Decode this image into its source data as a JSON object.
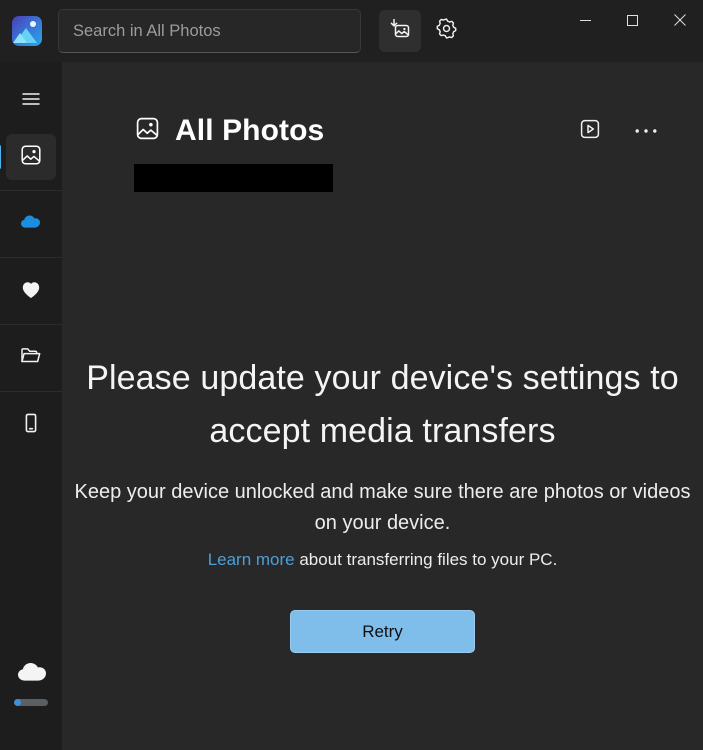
{
  "window": {
    "app_logo": "photos-app-logo",
    "controls": {
      "minimize": "minimize-icon",
      "maximize": "maximize-icon",
      "close": "close-icon"
    }
  },
  "search": {
    "placeholder": "Search in All Photos",
    "value": ""
  },
  "toolbar": {
    "import_icon": "import-photos-icon",
    "settings_icon": "settings-gear-icon"
  },
  "sidebar": {
    "items": [
      {
        "name": "menu",
        "icon": "hamburger-menu-icon",
        "selected": false
      },
      {
        "name": "all-photos",
        "icon": "photos-icon",
        "selected": true
      },
      {
        "name": "onedrive",
        "icon": "cloud-icon",
        "selected": false
      },
      {
        "name": "favorites",
        "icon": "heart-icon",
        "selected": false
      },
      {
        "name": "folders",
        "icon": "folder-icon",
        "selected": false
      },
      {
        "name": "phone",
        "icon": "mobile-device-icon",
        "selected": false
      }
    ],
    "status": {
      "icon": "cloud-sync-icon",
      "progress_percent": 22
    }
  },
  "page": {
    "icon": "photos-icon",
    "title": "All Photos",
    "slideshow_icon": "slideshow-play-icon",
    "more_icon": "more-options-icon",
    "redaction": ""
  },
  "empty_state": {
    "heading": "Please update your device's settings to accept media transfers",
    "subtitle": "Keep your device unlocked and make sure there are photos or videos on your device.",
    "learn_more_link": "Learn more",
    "learn_more_rest": " about transferring files to your PC.",
    "retry_label": "Retry"
  },
  "colors": {
    "accent": "#4cb2f0",
    "link": "#4d9fd8",
    "button": "#7fbdeb",
    "sidebar_bg": "#1d1d1d",
    "content_bg": "#282828",
    "titlebar_bg": "#202020"
  }
}
